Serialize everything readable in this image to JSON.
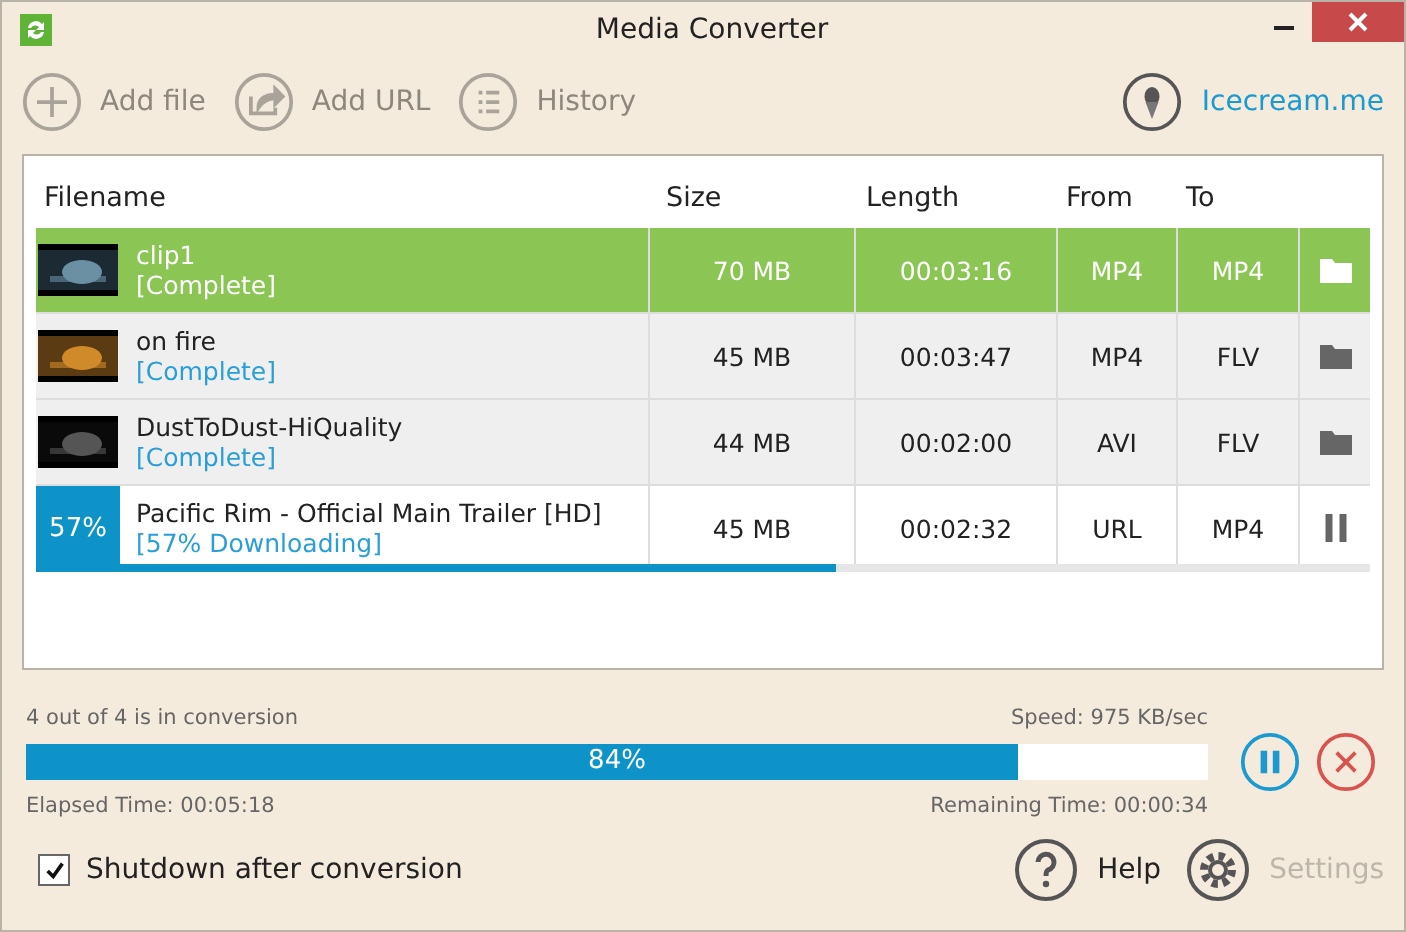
{
  "window": {
    "title": "Media Converter"
  },
  "toolbar": [
    {
      "label": "Add file",
      "kind": "plus"
    },
    {
      "label": "Add URL",
      "kind": "share"
    },
    {
      "label": "History",
      "kind": "list"
    }
  ],
  "brand_link": "Icecream.me",
  "table": {
    "columns": [
      "Filename",
      "Size",
      "Length",
      "From",
      "To"
    ],
    "rows": [
      {
        "kind": "complete",
        "selected": true,
        "name": "clip1",
        "status": "[Complete]",
        "size": "70 MB",
        "length": "00:03:16",
        "from": "MP4",
        "to": "MP4"
      },
      {
        "kind": "complete",
        "selected": false,
        "name": "on fire",
        "status": "[Complete]",
        "size": "45 MB",
        "length": "00:03:47",
        "from": "MP4",
        "to": "FLV"
      },
      {
        "kind": "complete",
        "selected": false,
        "name": "DustToDust-HiQuality",
        "status": "[Complete]",
        "size": "44 MB",
        "length": "00:02:00",
        "from": "AVI",
        "to": "FLV"
      },
      {
        "kind": "downloading",
        "selected": false,
        "percent": "57%",
        "level": 0.6,
        "name": "Pacific Rim - Official Main Trailer [HD]",
        "status": "[57% Downloading]",
        "size": "45 MB",
        "length": "00:02:32",
        "from": "URL",
        "to": "MP4"
      }
    ]
  },
  "progress": {
    "summary": "4 out of 4 is in conversion",
    "speed": "Speed: 975 KB/sec",
    "level": 0.84,
    "percent": "84%",
    "elapsed": "Elapsed Time: 00:05:18",
    "remaining": "Remaining Time: 00:00:34"
  },
  "shutdown": {
    "label": "Shutdown after conversion",
    "checked": true
  },
  "footer": [
    {
      "label": "Help",
      "kind": "help",
      "disabled": false
    },
    {
      "label": "Settings",
      "kind": "settings",
      "disabled": true
    }
  ]
}
